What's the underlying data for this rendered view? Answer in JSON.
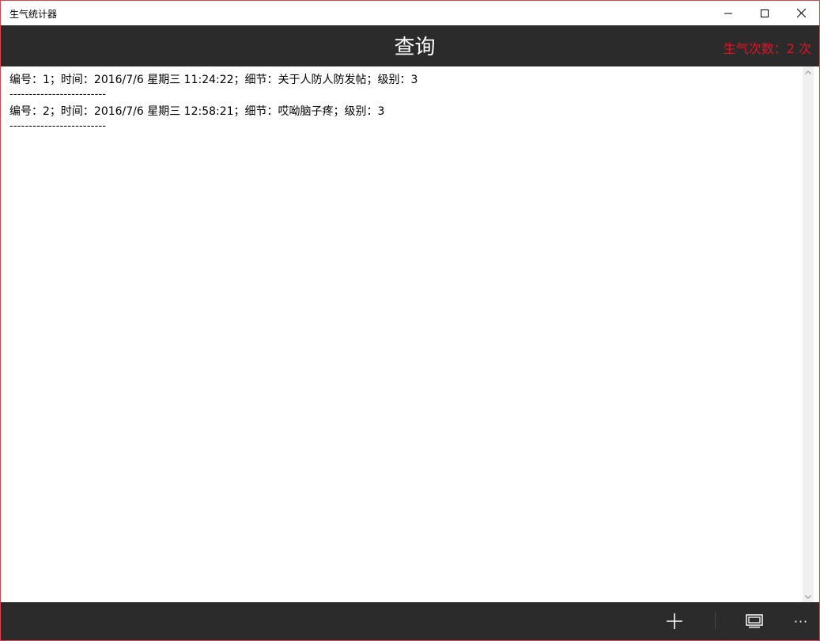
{
  "window": {
    "title": "生气统计器"
  },
  "header": {
    "page_title": "查询",
    "count_text": "生气次数：2 次"
  },
  "records": [
    {
      "text": "编号：1；时间：2016/7/6 星期三 11:24:22；细节：关于人防人防发帖；级别：3",
      "separator": "-------------------------"
    },
    {
      "text": "编号：2；时间：2016/7/6 星期三 12:58:21；细节：哎呦脑子疼；级别：3",
      "separator": "-------------------------"
    }
  ],
  "appbar": {
    "icons": [
      "add-icon",
      "display-icon",
      "more-icon"
    ],
    "more_label": "···"
  },
  "colors": {
    "header_bg": "#2b2b2b",
    "count_red": "#e81123",
    "window_border": "#d9454f"
  }
}
